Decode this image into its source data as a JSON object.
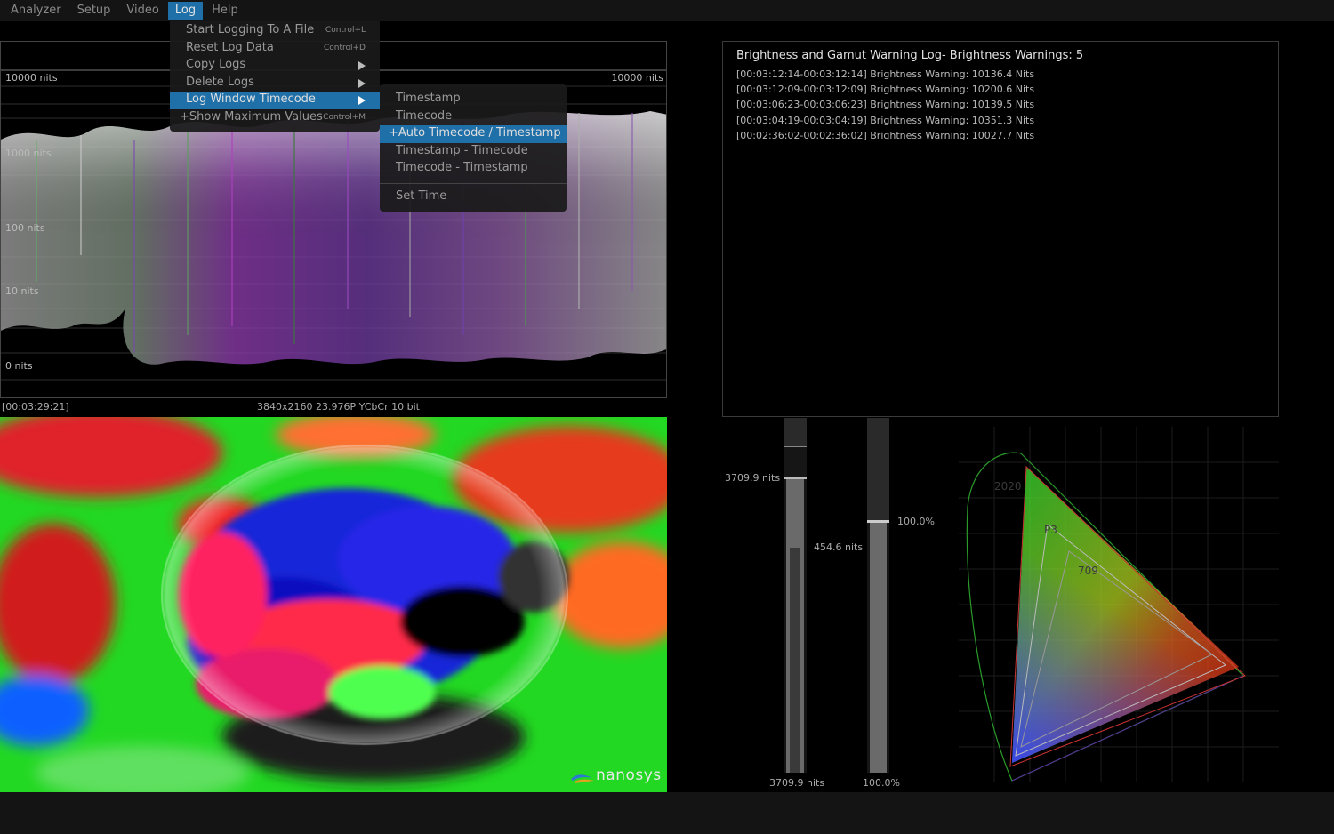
{
  "menubar": {
    "items": [
      "Analyzer",
      "Setup",
      "Video",
      "Log",
      "Help"
    ],
    "active": "Log"
  },
  "log_menu": {
    "items": [
      {
        "label": "Start Logging To A File",
        "shortcut": "Control+L"
      },
      {
        "label": "Reset Log Data",
        "shortcut": "Control+D"
      },
      {
        "label": "Copy Logs",
        "submenu": true
      },
      {
        "label": "Delete Logs",
        "submenu": true
      },
      {
        "label": "Log Window Timecode",
        "submenu": true,
        "highlighted": true
      },
      {
        "label": "+Show Maximum Values",
        "shortcut": "Control+M"
      }
    ]
  },
  "timecode_submenu": {
    "items": [
      {
        "label": "Timestamp"
      },
      {
        "label": "Timecode"
      },
      {
        "label": "+Auto Timecode / Timestamp",
        "highlighted": true
      },
      {
        "label": "Timestamp - Timecode"
      },
      {
        "label": "Timecode - Timestamp"
      }
    ],
    "set_time": "Set Time"
  },
  "waveform": {
    "label_top_left": "10000 nits",
    "label_top_right": "10000 nits",
    "label_1000": "1000 nits",
    "label_100": "100 nits",
    "label_10": "10 nits",
    "label_0": "0 nits"
  },
  "status": {
    "timecode": "[00:03:29:21]",
    "format": "3840x2160 23.976P YCbCr 10 bit"
  },
  "video": {
    "logo_text": "nanosys"
  },
  "log_panel": {
    "title": "Brightness and Gamut Warning Log- Brightness Warnings: 5",
    "entries": [
      "[00:03:12:14-00:03:12:14] Brightness Warning: 10136.4 Nits",
      "[00:03:12:09-00:03:12:09] Brightness Warning: 10200.6 Nits",
      "[00:03:06:23-00:03:06:23] Brightness Warning: 10139.5 Nits",
      "[00:03:04:19-00:03:04:19] Brightness Warning: 10351.3 Nits",
      "[00:02:36:02-00:02:36:02] Brightness Warning: 10027.7 Nits"
    ]
  },
  "meters": {
    "max_nits_label": "3709.9 nits",
    "avg_nits_label": "454.6 nits",
    "bottom_nits_label": "3709.9 nits",
    "percent_label": "100.0%",
    "bottom_percent_label": "100.0%"
  },
  "gamut": {
    "labels": [
      "2020",
      "P3",
      "709"
    ]
  }
}
